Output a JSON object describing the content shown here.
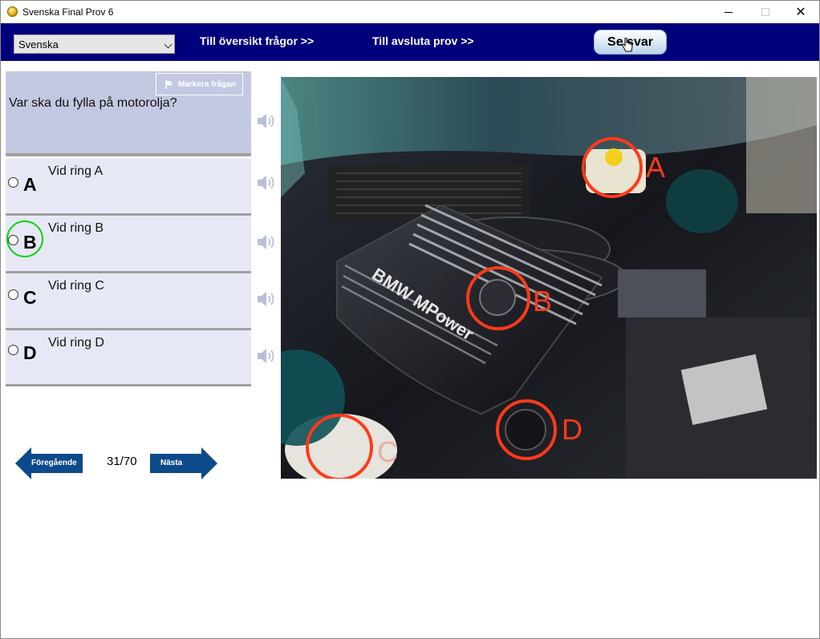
{
  "window": {
    "title": "Svenska Final Prov 6",
    "minimize": "",
    "maximize": "",
    "close": "✕"
  },
  "toolbar": {
    "language_value": "Svenska",
    "overview_link": "Till översikt frågor >>",
    "finish_link": "Till avsluta prov  >>",
    "answer_button": "Se svar"
  },
  "question": {
    "mark_button": "Markera frågan",
    "text": "Var ska du fylla på motorolja?"
  },
  "options": [
    {
      "letter": "A",
      "text": "Vid ring A"
    },
    {
      "letter": "B",
      "text": "Vid ring B"
    },
    {
      "letter": "C",
      "text": "Vid ring C"
    },
    {
      "letter": "D",
      "text": "Vid ring D"
    }
  ],
  "navigation": {
    "previous": "Föregående",
    "next": "Nästa",
    "counter": "31/70"
  },
  "image": {
    "engine_text": "BMW MPower",
    "ring_labels": [
      "A",
      "B",
      "C",
      "D"
    ]
  },
  "colors": {
    "toolbar_bg": "#00007d",
    "question_bg": "#c3c9e2",
    "option_bg": "#e6e9f5",
    "nav_arrow": "#0d4a8a",
    "ring_red": "#ff3a1a",
    "selection_green": "#12d012"
  }
}
